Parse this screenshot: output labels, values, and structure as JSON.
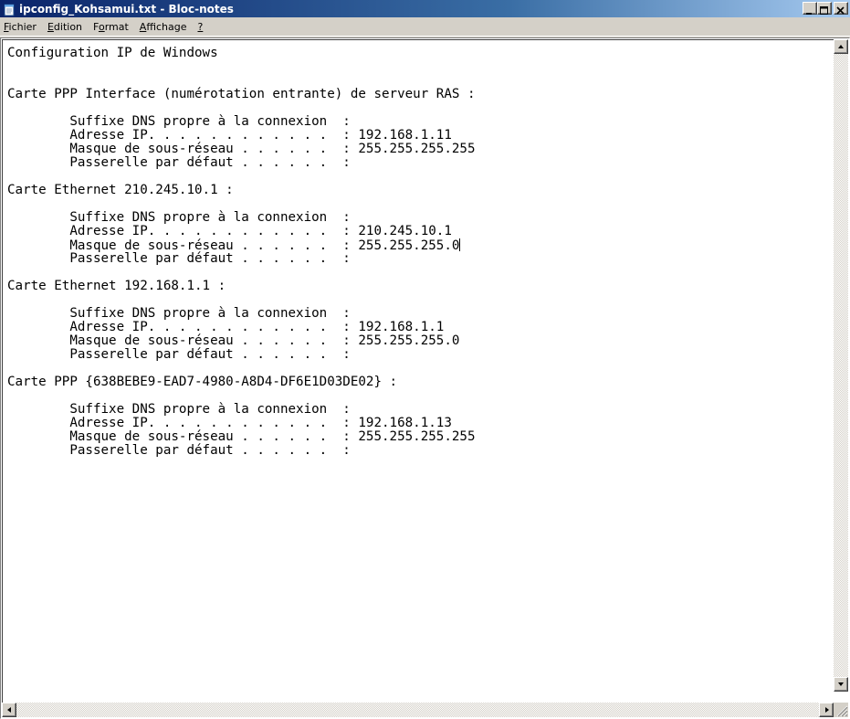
{
  "window": {
    "title": "ipconfig_Kohsamui.txt - Bloc-notes",
    "accent_color": "#0a246a",
    "icon": "notepad-icon"
  },
  "title_buttons": {
    "minimize": "minimize-icon",
    "maximize": "maximize-icon",
    "close": "close-icon"
  },
  "menu": [
    {
      "underline": "F",
      "rest": "ichier"
    },
    {
      "underline": "E",
      "rest": "dition"
    },
    {
      "pre": "F",
      "underline": "o",
      "rest": "rmat"
    },
    {
      "underline": "A",
      "rest": "ffichage"
    },
    {
      "underline": "?",
      "rest": ""
    }
  ],
  "document": {
    "lines": [
      "Configuration IP de Windows",
      "",
      "",
      "Carte PPP Interface (numérotation entrante) de serveur RAS :",
      "",
      "        Suffixe DNS propre à la connexion  :",
      "        Adresse IP. . . . . . . . . . . .  : 192.168.1.11",
      "        Masque de sous-réseau . . . . . .  : 255.255.255.255",
      "        Passerelle par défaut . . . . . .  :",
      "",
      "Carte Ethernet 210.245.10.1 :",
      "",
      "        Suffixe DNS propre à la connexion  :",
      "        Adresse IP. . . . . . . . . . . .  : 210.245.10.1",
      "        Masque de sous-réseau . . . . . .  : 255.255.255.0",
      "        Passerelle par défaut . . . . . .  :",
      "",
      "Carte Ethernet 192.168.1.1 :",
      "",
      "        Suffixe DNS propre à la connexion  :",
      "        Adresse IP. . . . . . . . . . . .  : 192.168.1.1",
      "        Masque de sous-réseau . . . . . .  : 255.255.255.0",
      "        Passerelle par défaut . . . . . .  :",
      "",
      "Carte PPP {638BEBE9-EAD7-4980-A8D4-DF6E1D03DE02} :",
      "",
      "        Suffixe DNS propre à la connexion  :",
      "        Adresse IP. . . . . . . . . . . .  : 192.168.1.13",
      "        Masque de sous-réseau . . . . . .  : 255.255.255.255",
      "        Passerelle par défaut . . . . . .  :"
    ],
    "caret_line": 14
  }
}
